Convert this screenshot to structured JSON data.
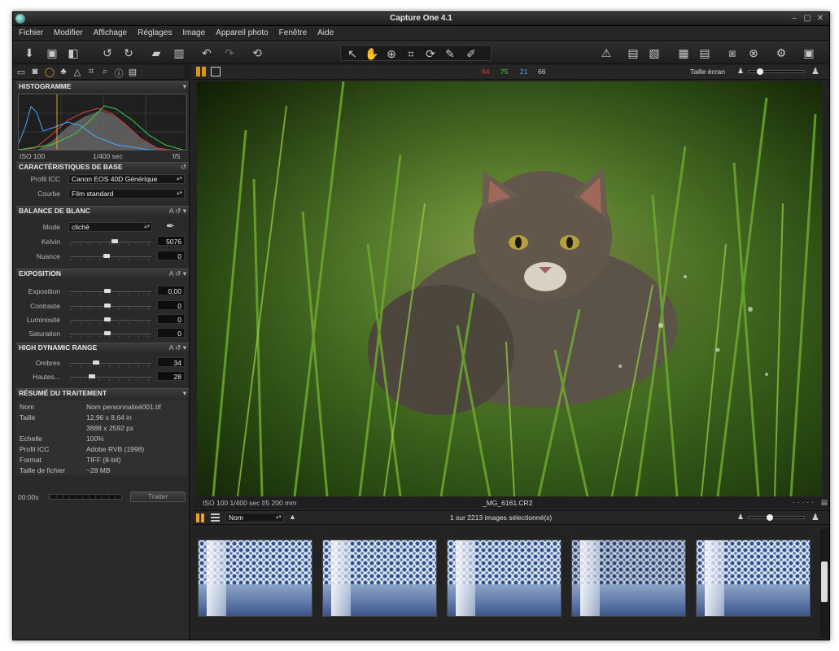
{
  "window": {
    "title": "Capture One 4.1"
  },
  "menu": [
    "Fichier",
    "Modifier",
    "Affichage",
    "Réglages",
    "Image",
    "Appareil photo",
    "Fenêtre",
    "Aide"
  ],
  "histogram": {
    "title": "HISTOGRAMME",
    "iso": "ISO 100",
    "shutter": "1/400 sec",
    "aperture": "f/5"
  },
  "basic": {
    "title": "CARACTÉRISTIQUES DE BASE",
    "profile_label": "Profil ICC",
    "profile_value": "Canon EOS 40D Générique",
    "curve_label": "Courbe",
    "curve_value": "Film standard"
  },
  "white_balance": {
    "title": "BALANCE DE BLANC",
    "mode_label": "Mode",
    "mode_value": "cliché",
    "kelvin_label": "Kelvin",
    "kelvin_value": "5076",
    "nuance_label": "Nuance",
    "nuance_value": "0",
    "kelvin_level": 0.55,
    "nuance_level": 0.45
  },
  "exposure": {
    "title": "EXPOSITION",
    "rows": [
      {
        "label": "Exposition",
        "value": "0,00",
        "level": 0.46
      },
      {
        "label": "Contraste",
        "value": "0",
        "level": 0.46
      },
      {
        "label": "Luminosité",
        "value": "0",
        "level": 0.46
      },
      {
        "label": "Saturation",
        "value": "0",
        "level": 0.46
      }
    ]
  },
  "hdr": {
    "title": "HIGH DYNAMIC RANGE",
    "rows": [
      {
        "label": "Ombres",
        "value": "34",
        "level": 0.3
      },
      {
        "label": "Hautes...",
        "value": "28",
        "level": 0.25
      }
    ]
  },
  "summary": {
    "title": "RÉSUMÉ DU TRAITEMENT",
    "rows": [
      {
        "label": "Nom",
        "value": "Nom personnalisé001.tif"
      },
      {
        "label": "Taille",
        "value": "12,96  x  8,64  in"
      },
      {
        "label": "",
        "value": "3888  x  2592  px"
      },
      {
        "label": "Echelle",
        "value": "100%"
      },
      {
        "label": "Profil ICC",
        "value": "Adobe RVB (1998)"
      },
      {
        "label": "Format",
        "value": "TIFF (8-bit)"
      },
      {
        "label": "Taille de fichier",
        "value": "~28 MB"
      }
    ]
  },
  "process": {
    "time": "00:00s",
    "button": "Traiter"
  },
  "viewer": {
    "rgb": {
      "r": "64",
      "g": "75",
      "b": "21",
      "l": "66"
    },
    "zoom_label": "Taille écran",
    "info": "ISO 100  1/400 sec  f/5  200 mm",
    "filename": "_MG_6161.CR2"
  },
  "browser": {
    "sort_value": "Nom",
    "count": "1 sur 2213 images sélectionné(s)",
    "thumbnail_count": 5
  },
  "colors": {
    "accent_orange": "#f0a020",
    "red": "#e04040",
    "green": "#40d040",
    "blue": "#4aa8ff"
  }
}
